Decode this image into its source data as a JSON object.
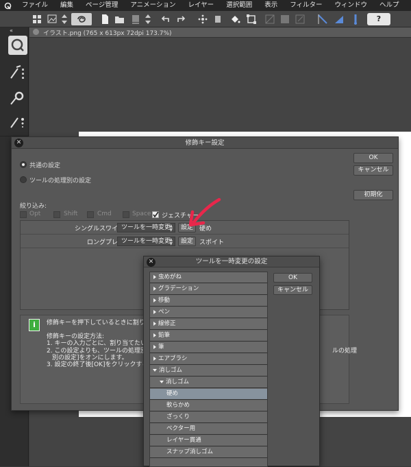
{
  "menubar": {
    "items": [
      "ファイル",
      "編集",
      "ページ管理",
      "アニメーション",
      "レイヤー",
      "選択範囲",
      "表示",
      "フィルター",
      "ウィンドウ",
      "ヘルプ"
    ]
  },
  "toolbar": {
    "help_label": "?"
  },
  "document": {
    "tab_title": "イラスト.png (765 x 613px 72dpi 173.7%)"
  },
  "modifier_dialog": {
    "title": "修飾キー設定",
    "ok_label": "OK",
    "cancel_label": "キャンセル",
    "reset_label": "初期化",
    "radio_common": "共通の設定",
    "radio_per_tool": "ツールの処理別の設定",
    "filter_label": "絞り込み:",
    "filters": [
      {
        "label": "Opt",
        "checked": false
      },
      {
        "label": "Shift",
        "checked": false
      },
      {
        "label": "Cmd",
        "checked": false
      },
      {
        "label": "Space",
        "checked": false
      },
      {
        "label": "ジェスチャー",
        "checked": true
      }
    ],
    "rows": [
      {
        "gesture": "シングルスワイプ:",
        "action": "ツールを一時変更",
        "button": "設定",
        "value": "硬め"
      },
      {
        "gesture": "ロングプレス:",
        "action": "ツールを一時変更",
        "button": "設定",
        "value": "スポイト"
      }
    ],
    "help": {
      "line1": "修飾キーを押下しているときに割り当て",
      "line2": "修飾キーの設定方法:",
      "line3": "1. キーの入力ごとに、割り当てたい動作",
      "line4": "2. この設定よりも、ツールの処理別の設",
      "line4_tail": "ルの処理",
      "line5": "別の設定]をオンにします。",
      "line6": "3. 設定の終了後[OK]をクリックすると、"
    }
  },
  "tool_dialog": {
    "title": "ツールを一時変更の設定",
    "ok_label": "OK",
    "cancel_label": "キャンセル",
    "items": [
      {
        "label": "虫めがね",
        "level": 0,
        "expanded": false,
        "selected": false
      },
      {
        "label": "グラデーション",
        "level": 0,
        "expanded": false,
        "selected": false
      },
      {
        "label": "移動",
        "level": 0,
        "expanded": false,
        "selected": false
      },
      {
        "label": "ペン",
        "level": 0,
        "expanded": false,
        "selected": false
      },
      {
        "label": "線修正",
        "level": 0,
        "expanded": false,
        "selected": false
      },
      {
        "label": "鉛筆",
        "level": 0,
        "expanded": false,
        "selected": false
      },
      {
        "label": "筆",
        "level": 0,
        "expanded": false,
        "selected": false
      },
      {
        "label": "エアブラシ",
        "level": 0,
        "expanded": false,
        "selected": false
      },
      {
        "label": "消しゴム",
        "level": 0,
        "expanded": true,
        "selected": false
      },
      {
        "label": "消しゴム",
        "level": 1,
        "expanded": true,
        "selected": false
      },
      {
        "label": "硬め",
        "level": 2,
        "expanded": null,
        "selected": true
      },
      {
        "label": "軟らかめ",
        "level": 2,
        "expanded": null,
        "selected": false
      },
      {
        "label": "ざっくり",
        "level": 2,
        "expanded": null,
        "selected": false
      },
      {
        "label": "ベクター用",
        "level": 2,
        "expanded": null,
        "selected": false
      },
      {
        "label": "レイヤー貫通",
        "level": 2,
        "expanded": null,
        "selected": false
      },
      {
        "label": "スナップ消しゴム",
        "level": 2,
        "expanded": null,
        "selected": false
      }
    ]
  },
  "colors": {
    "annotation_arrow": "#e8274b",
    "selection": "#87939e",
    "panel": "#575757"
  }
}
